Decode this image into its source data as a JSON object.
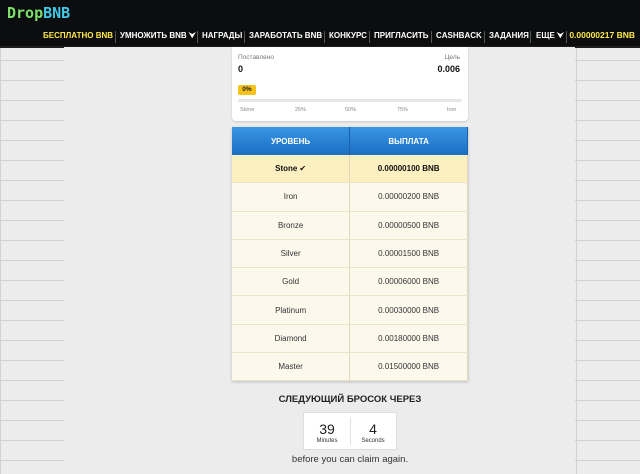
{
  "header": {
    "logo_part1": "Drop",
    "logo_part2": "BNB",
    "nav": [
      {
        "label": "БЕСПЛАТНО BNB"
      },
      {
        "label": "УМНОЖИТЬ BNB ⮟"
      },
      {
        "label": "НАГРАДЫ"
      },
      {
        "label": "ЗАРАБОТАТЬ BNB"
      },
      {
        "label": "КОНКУРС"
      },
      {
        "label": "ПРИГЛАСИТЬ"
      },
      {
        "label": "CASHBACK"
      },
      {
        "label": "ЗАДАНИЯ"
      },
      {
        "label": "ЕЩЕ ⮟"
      }
    ],
    "balance": "0.00000217 BNB"
  },
  "progress": {
    "deposited_label": "Поставлено",
    "deposited_value": "0",
    "target_label": "Цель",
    "target_value": "0.006",
    "percent_label": "0%",
    "percent_value": 0,
    "ticks": [
      "Stone",
      "25%",
      "50%",
      "75%",
      "Iron"
    ]
  },
  "tiers": {
    "headers": [
      "УРОВЕНЬ",
      "ВЫПЛАТА"
    ],
    "check_mark": "✔",
    "rows": [
      {
        "level": "Stone",
        "payout": "0.00000100 BNB",
        "current": true
      },
      {
        "level": "Iron",
        "payout": "0.00000200 BNB",
        "current": false
      },
      {
        "level": "Bronze",
        "payout": "0.00000500 BNB",
        "current": false
      },
      {
        "level": "Silver",
        "payout": "0.00001500 BNB",
        "current": false
      },
      {
        "level": "Gold",
        "payout": "0.00006000 BNB",
        "current": false
      },
      {
        "level": "Platinum",
        "payout": "0.00030000 BNB",
        "current": false
      },
      {
        "level": "Diamond",
        "payout": "0.00180000 BNB",
        "current": false
      },
      {
        "level": "Master",
        "payout": "0.01500000 BNB",
        "current": false
      }
    ]
  },
  "countdown": {
    "title": "СЛЕДУЮЩИЙ БРОСОК ЧЕРЕЗ",
    "minutes": "39",
    "minutes_label": "Minutes",
    "seconds": "4",
    "seconds_label": "Seconds",
    "note": "before you can claim again."
  },
  "colors": {
    "accent_yellow": "#ffe94a",
    "header_blue": "#1a6fc4",
    "progress_yellow": "#f4c21a"
  }
}
